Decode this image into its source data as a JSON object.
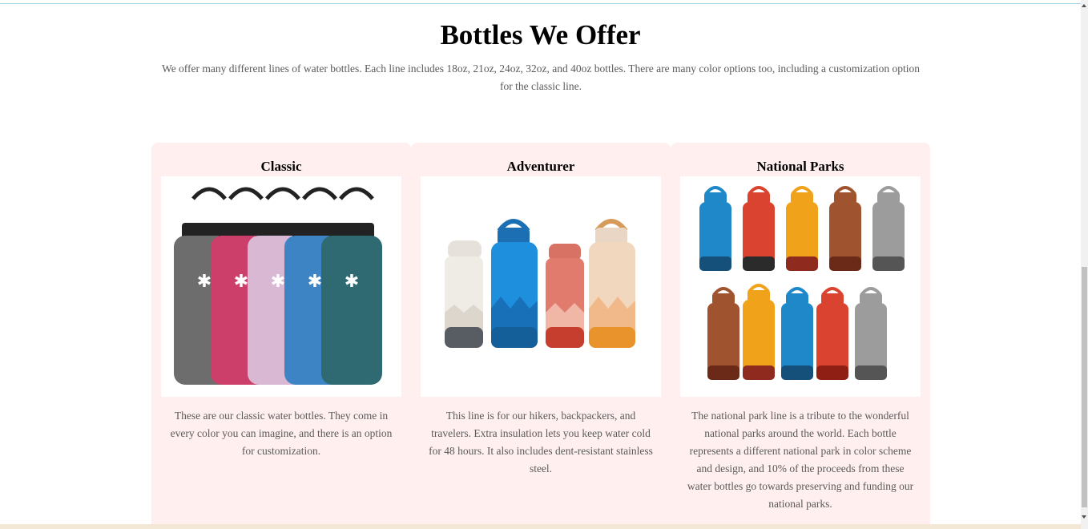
{
  "section": {
    "title": "Bottles We Offer",
    "intro": "We offer many different lines of water bottles. Each line includes 18oz, 21oz, 24oz, 32oz, and 40oz bottles. There are many color options too, including a customization option for the classic line."
  },
  "cards": [
    {
      "title": "Classic",
      "image_icon": "bottles-classic-image",
      "description": "These are our classic water bottles. They come in every color you can imagine, and there is an option for customization."
    },
    {
      "title": "Adventurer",
      "image_icon": "bottles-adventurer-image",
      "description": "This line is for our hikers, backpackers, and travelers. Extra insulation lets you keep water cold for 48 hours. It also includes dent-resistant stainless steel."
    },
    {
      "title": "National Parks",
      "image_icon": "bottles-national-parks-image",
      "description": "The national park line is a tribute to the wonderful national parks around the world. Each bottle represents a different national park in color scheme and design, and 10% of the proceeds from these water bottles go towards preserving and funding our national parks."
    }
  ],
  "colors": {
    "card_background": "#fff0ef",
    "classic_bottles": [
      "#6d6d6d",
      "#cc3f6a",
      "#d8b8d3",
      "#3d84c4",
      "#2f6a73"
    ],
    "adventurer_bottles": [
      "#ece8e2",
      "#1e8fdc",
      "#e07b6e",
      "#f2d7bf"
    ],
    "national_parks_bottles": [
      "#1f88c9",
      "#d9432f",
      "#f0a21b",
      "#a0532f",
      "#9c9c9c",
      "#a0532f",
      "#f0a21b",
      "#1f88c9",
      "#d9432f",
      "#9c9c9c"
    ]
  }
}
